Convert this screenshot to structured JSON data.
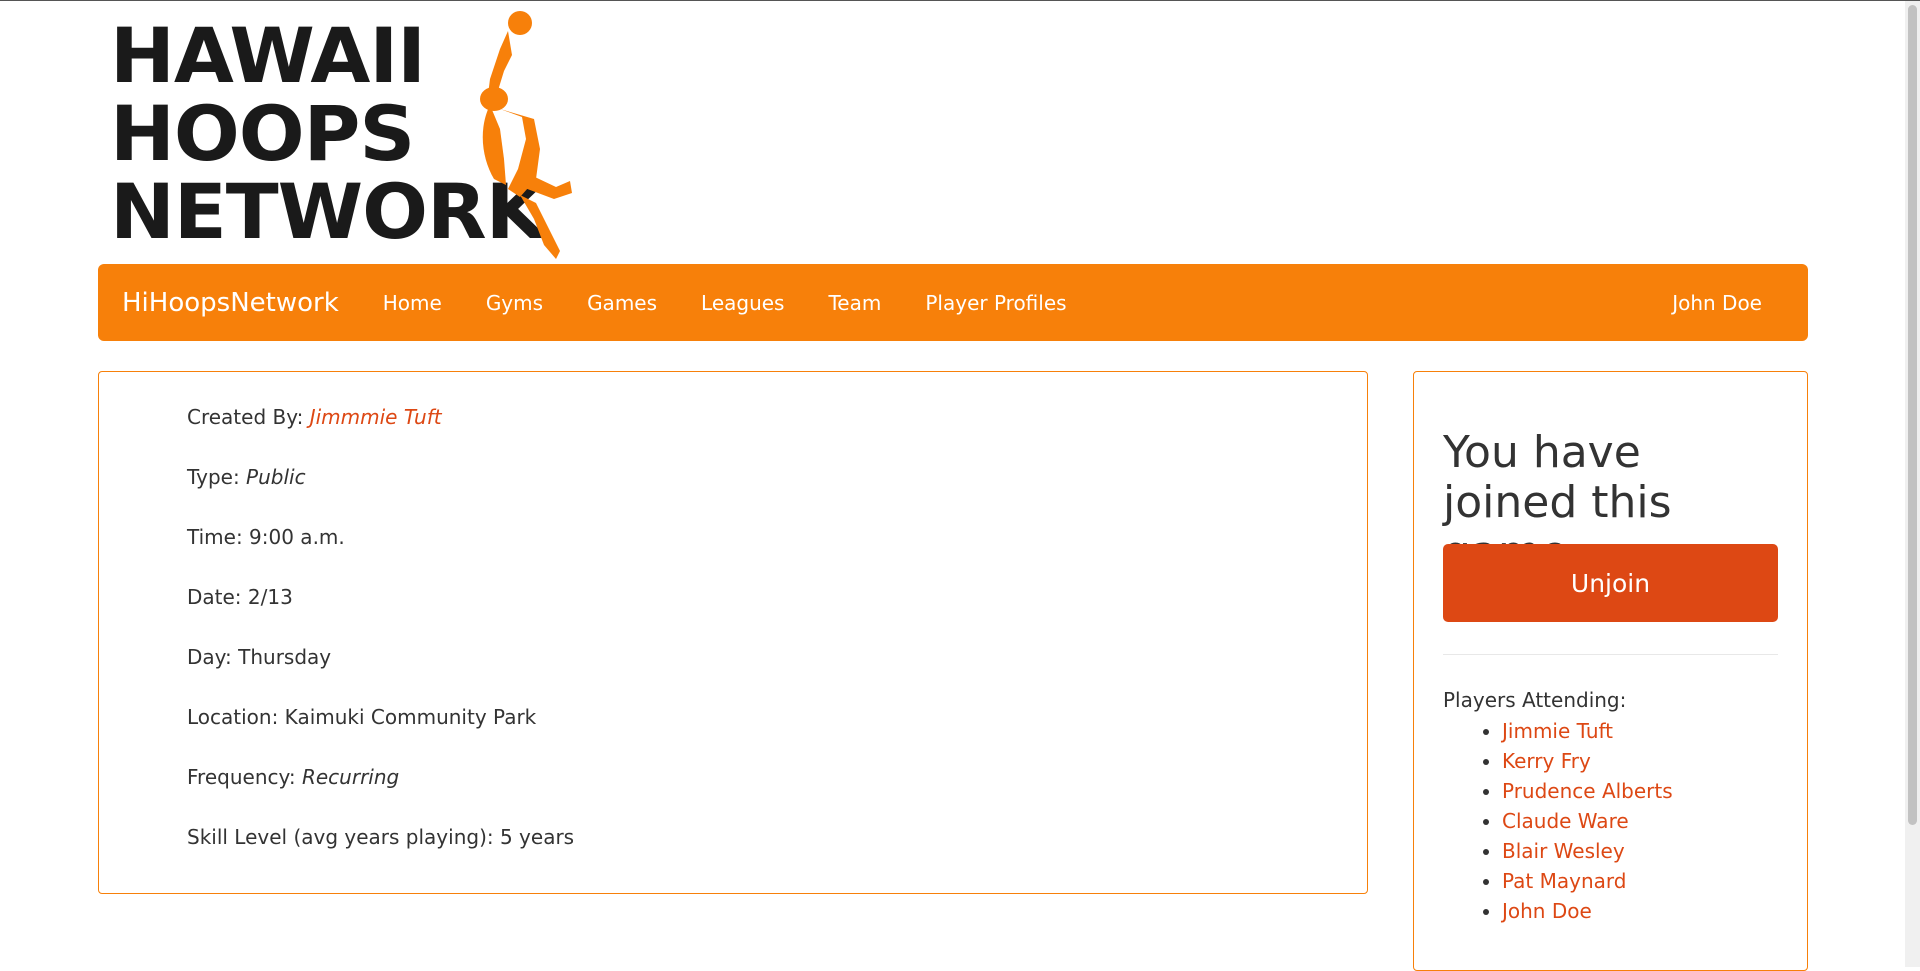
{
  "logo": {
    "lines": [
      "HAWAII",
      "HOOPS",
      "NETWORK"
    ],
    "icon": "basketball-player-icon",
    "accent": "#f7800a"
  },
  "navbar": {
    "brand": "HiHoopsNetwork",
    "items": [
      "Home",
      "Gyms",
      "Games",
      "Leagues",
      "Team",
      "Player Profiles"
    ],
    "user": "John Doe",
    "color": "#f7800a"
  },
  "game": {
    "created_by_label": "Created By:",
    "created_by": "Jimmmie Tuft",
    "type_label": "Type:",
    "type": "Public",
    "time": "Time: 9:00 a.m.",
    "date": "Date: 2/13",
    "day": "Day: Thursday",
    "location": "Location: Kaimuki Community Park",
    "frequency_label": "Frequency:",
    "frequency": "Recurring",
    "skill": "Skill Level (avg years playing): 5 years"
  },
  "sidebar": {
    "heading": "You have joined this game",
    "unjoin_label": "Unjoin",
    "attending_label": "Players Attending:",
    "players": [
      "Jimmie Tuft",
      "Kerry Fry",
      "Prudence Alberts",
      "Claude Ware",
      "Blair Wesley",
      "Pat Maynard",
      "John Doe"
    ],
    "link_color": "#dd4814"
  }
}
